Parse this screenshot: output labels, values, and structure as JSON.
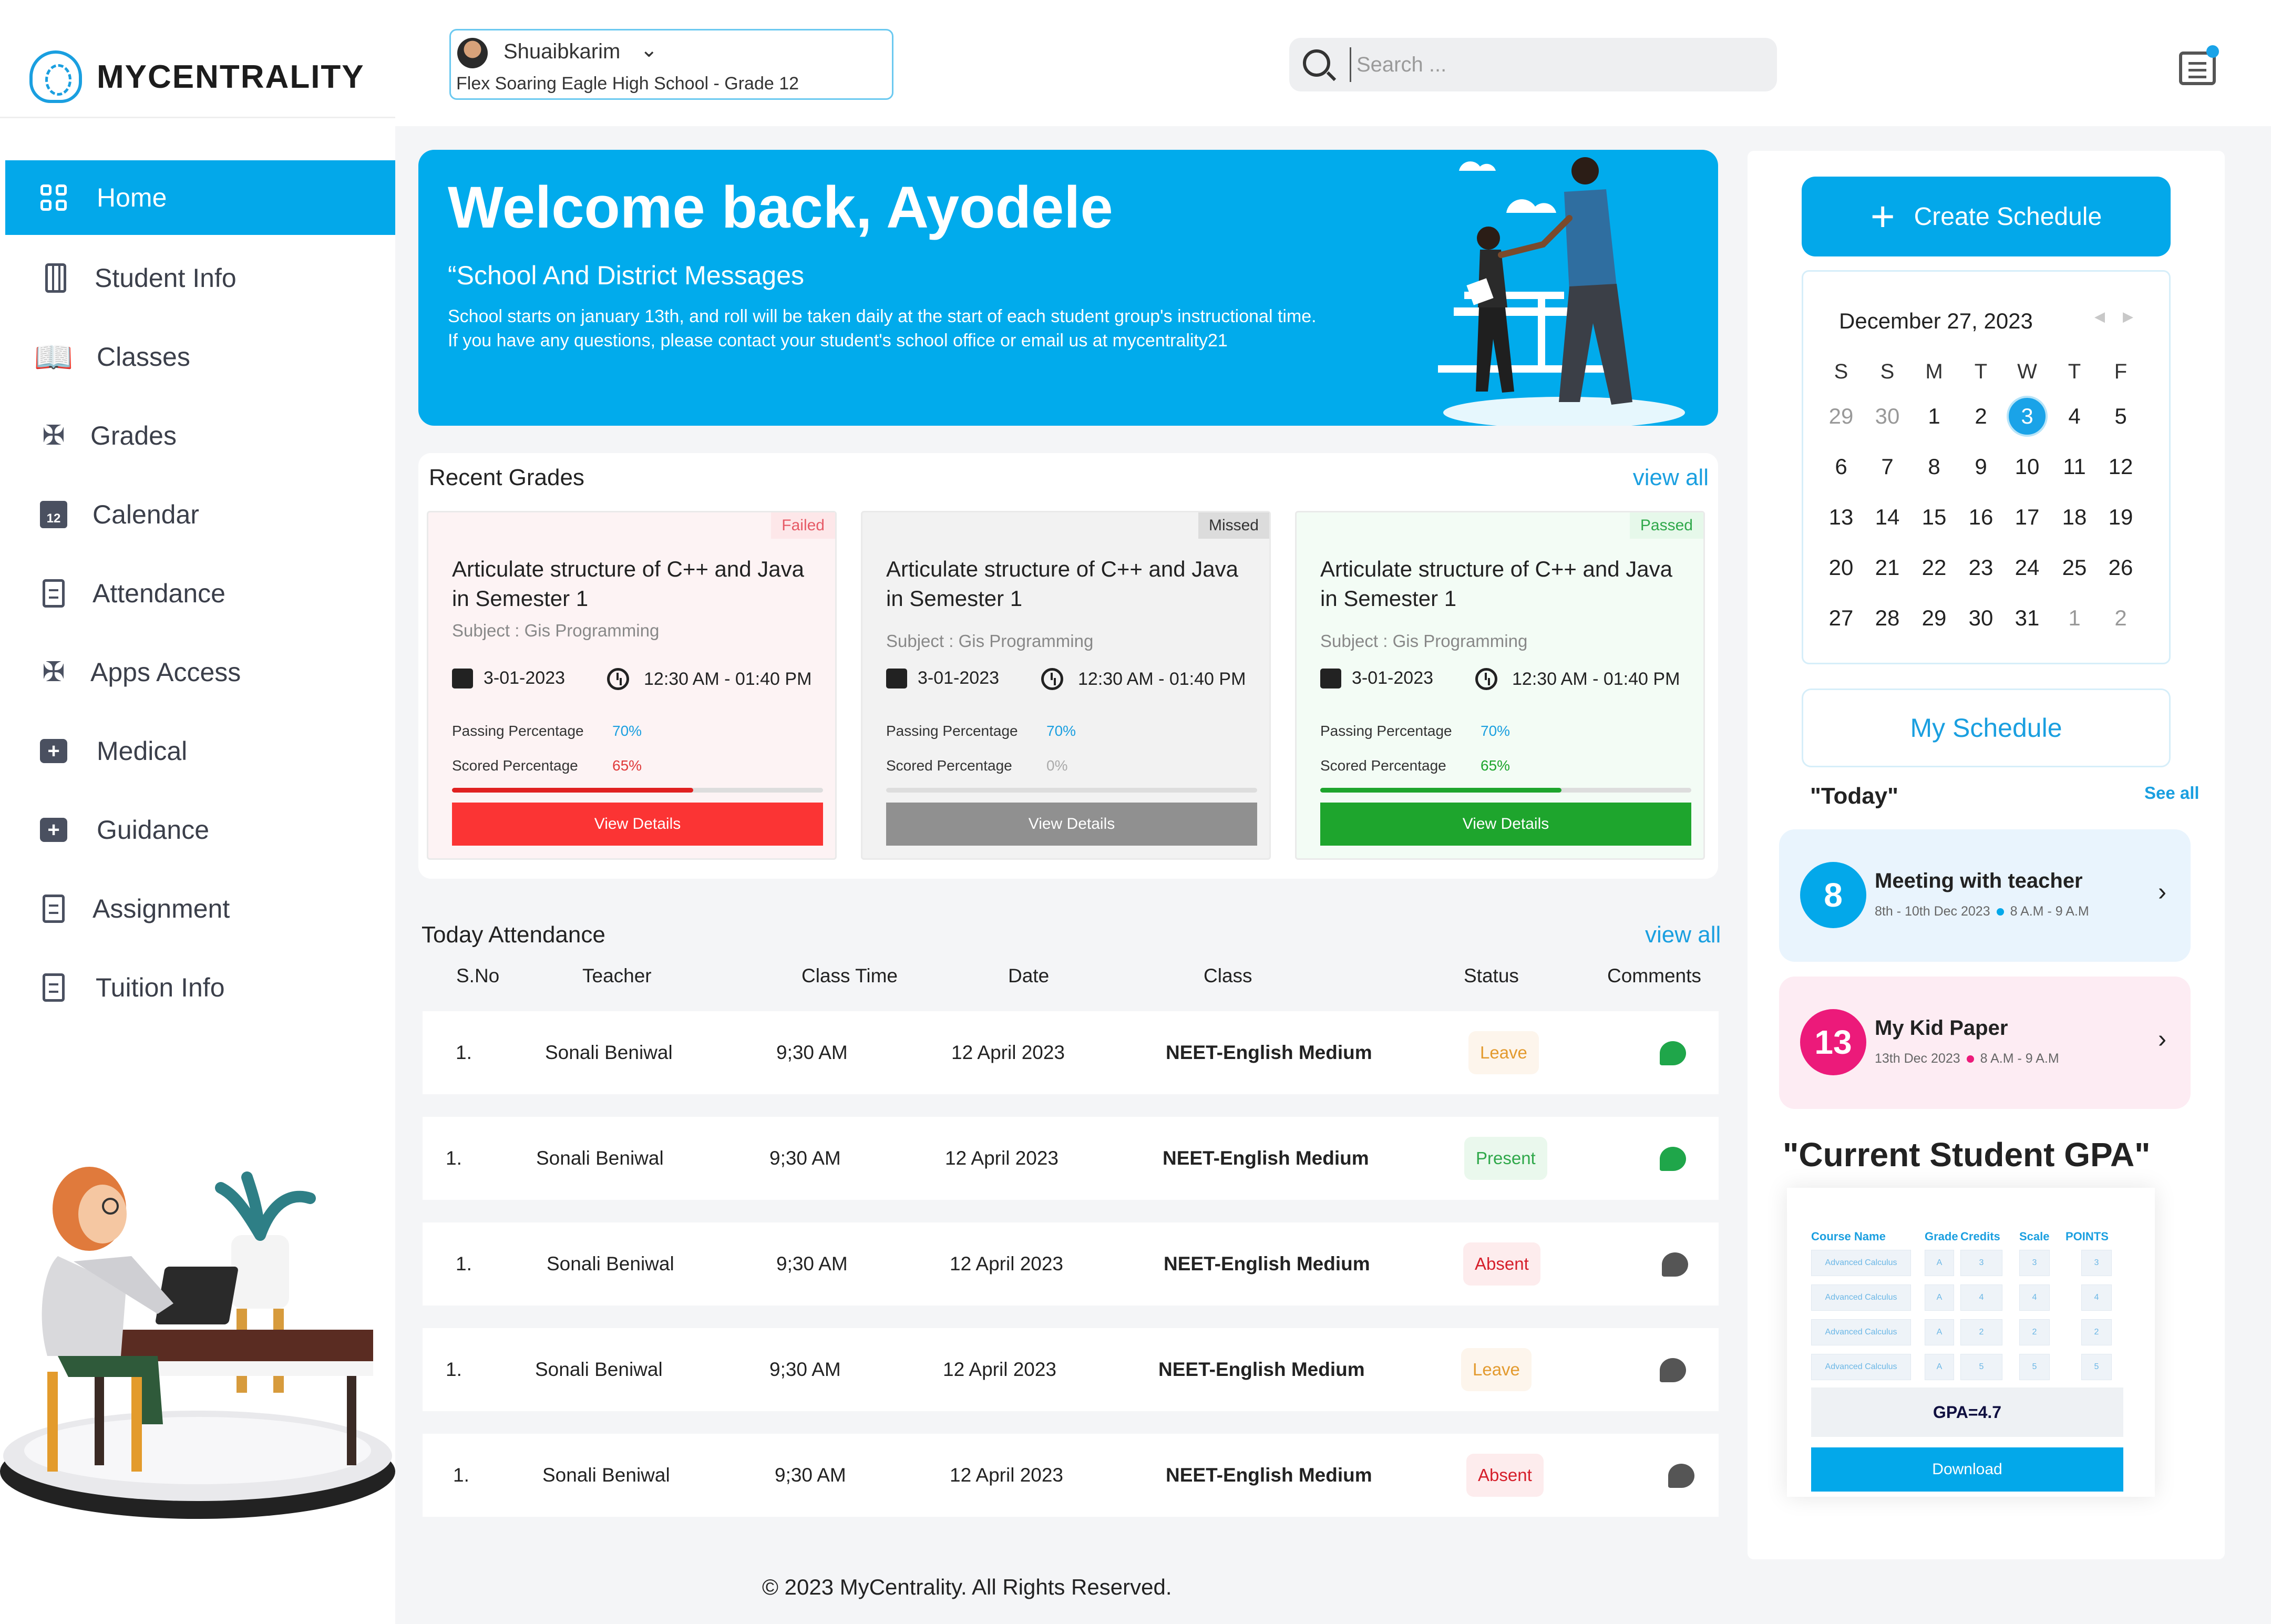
{
  "app": {
    "name": "MYCENTRALITY"
  },
  "sidebar": {
    "items": [
      {
        "label": "Home",
        "icon": "grid-icon",
        "active": true
      },
      {
        "label": "Student Info",
        "icon": "calculator-icon"
      },
      {
        "label": "Classes",
        "icon": "book-icon"
      },
      {
        "label": "Grades",
        "icon": "puzzle-icon"
      },
      {
        "label": "Calendar",
        "icon": "calendar-icon"
      },
      {
        "label": "Attendance",
        "icon": "document-icon"
      },
      {
        "label": "Apps Access",
        "icon": "puzzle-icon"
      },
      {
        "label": "Medical",
        "icon": "medical-kit-icon"
      },
      {
        "label": "Guidance",
        "icon": "medical-kit-icon"
      },
      {
        "label": "Assignment",
        "icon": "document-icon"
      },
      {
        "label": "Tuition Info",
        "icon": "document-icon"
      }
    ],
    "calendar_icon_text": "12"
  },
  "header": {
    "profile_name": "Shuaibkarim",
    "profile_school": "Flex Soaring Eagle High School - Grade 12",
    "search_placeholder": "Search ..."
  },
  "banner": {
    "title": "Welcome back, Ayodele",
    "subtitle": "“School And District Messages",
    "message_line1": "School starts on january 13th, and roll will be taken daily at the start of each student group's instructional time.",
    "message_line2": "If you have any questions, please contact your student's school office or email us at mycentrality21"
  },
  "grades": {
    "title": "Recent Grades",
    "view_all": "view all",
    "cards": [
      {
        "status": "Failed",
        "title": "Articulate structure of C++ and Java in Semester 1",
        "subject": "Subject : Gis Programming",
        "date": "3-01-2023",
        "time": "12:30 AM - 01:40 PM",
        "passing_label": "Passing Percentage",
        "passing": "70%",
        "scored_label": "Scored Percentage",
        "scored": "65%",
        "progress": 0.65,
        "button": "View Details"
      },
      {
        "status": "Missed",
        "title": "Articulate structure of C++ and Java in Semester 1",
        "subject": "Subject : Gis Programming",
        "date": "3-01-2023",
        "time": "12:30 AM - 01:40 PM",
        "passing_label": "Passing Percentage",
        "passing": "70%",
        "scored_label": "Scored Percentage",
        "scored": "0%",
        "progress": 0,
        "button": "View Details"
      },
      {
        "status": "Passed",
        "title": "Articulate structure of C++ and Java in Semester 1",
        "subject": "Subject : Gis Programming",
        "date": "3-01-2023",
        "time": "12:30 AM - 01:40 PM",
        "passing_label": "Passing Percentage",
        "passing": "70%",
        "scored_label": "Scored Percentage",
        "scored": "65%",
        "progress": 0.65,
        "button": "View Details"
      }
    ]
  },
  "attendance": {
    "title": "Today Attendance",
    "view_all": "view all",
    "headers": [
      "S.No",
      "Teacher",
      "Class Time",
      "Date",
      "Class",
      "Status",
      "Comments"
    ],
    "rows": [
      {
        "sno": "1.",
        "teacher": "Sonali Beniwal",
        "time": "9;30 AM",
        "date": "12 April 2023",
        "class": "NEET-English Medium",
        "status": "Leave",
        "comment_color": "#1fa64a"
      },
      {
        "sno": "1.",
        "teacher": "Sonali Beniwal",
        "time": "9;30 AM",
        "date": "12 April 2023",
        "class": "NEET-English Medium",
        "status": "Present",
        "comment_color": "#1fa64a"
      },
      {
        "sno": "1.",
        "teacher": "Sonali Beniwal",
        "time": "9;30 AM",
        "date": "12 April 2023",
        "class": "NEET-English Medium",
        "status": "Absent",
        "comment_color": "#555555"
      },
      {
        "sno": "1.",
        "teacher": "Sonali Beniwal",
        "time": "9;30 AM",
        "date": "12 April 2023",
        "class": "NEET-English Medium",
        "status": "Leave",
        "comment_color": "#555555"
      },
      {
        "sno": "1.",
        "teacher": "Sonali Beniwal",
        "time": "9;30 AM",
        "date": "12 April 2023",
        "class": "NEET-English Medium",
        "status": "Absent",
        "comment_color": "#555555"
      }
    ]
  },
  "footer": {
    "copyright": "© 2023 MyCentrality. All Rights Reserved."
  },
  "right": {
    "create_schedule": "Create Schedule",
    "calendar": {
      "month": "December 27, 2023",
      "weekdays": [
        "S",
        "S",
        "M",
        "T",
        "W",
        "T",
        "F"
      ],
      "weeks": [
        [
          "29",
          "30",
          "1",
          "2",
          "3",
          "4",
          "5"
        ],
        [
          "6",
          "7",
          "8",
          "9",
          "10",
          "11",
          "12"
        ],
        [
          "13",
          "14",
          "15",
          "16",
          "17",
          "18",
          "19"
        ],
        [
          "20",
          "21",
          "22",
          "23",
          "24",
          "25",
          "26"
        ],
        [
          "27",
          "28",
          "29",
          "30",
          "31",
          "1",
          "2"
        ]
      ],
      "selected": "3"
    },
    "my_schedule": "My Schedule",
    "today_label": "\"Today\"",
    "see_all": "See all",
    "schedule_items": [
      {
        "number": "8",
        "title": "Meeting with teacher",
        "dates": "8th - 10th Dec 2023",
        "time": "8 A.M - 9 A.M",
        "color": "#03a8ea",
        "bg": "#e9f4fd"
      },
      {
        "number": "13",
        "title": "My Kid Paper",
        "dates": "13th Dec 2023",
        "time": "8 A.M - 9 A.M",
        "color": "#ec1a7a",
        "bg": "#fdecf3"
      }
    ],
    "gpa": {
      "title": "\"Current Student GPA\"",
      "headers": [
        "Course Name",
        "Grade",
        "Credits",
        "Scale",
        "POINTS"
      ],
      "rows": [
        [
          "Advanced Calculus",
          "A",
          "3",
          "3",
          "3"
        ],
        [
          "Advanced Calculus",
          "A",
          "4",
          "4",
          "4"
        ],
        [
          "Advanced Calculus",
          "A",
          "2",
          "2",
          "2"
        ],
        [
          "Advanced Calculus",
          "A",
          "5",
          "5",
          "5"
        ]
      ],
      "value": "GPA=4.7",
      "download": "Download"
    }
  },
  "colors": {
    "accent": "#03a8ea",
    "failed": "#fb3434",
    "missed": "#909090",
    "passed": "#1ea52d"
  }
}
